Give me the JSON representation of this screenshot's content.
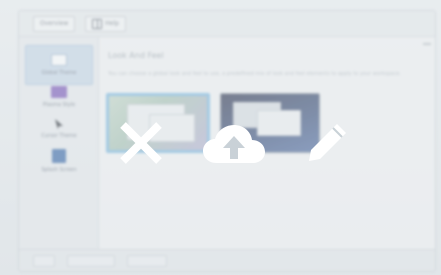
{
  "window": {
    "toolbar": {
      "left_button": "Overview",
      "right_button": "Help"
    },
    "sidebar": {
      "items": [
        {
          "label": "Global Theme",
          "icon": "theme-icon",
          "color": "#5a8fc6"
        },
        {
          "label": "Plasma Style",
          "icon": "plasma-icon",
          "color": "#7a58b8"
        },
        {
          "label": "Cursor Theme",
          "icon": "cursor-icon",
          "color": "#2b2f36"
        },
        {
          "label": "Splash Screen",
          "icon": "splash-icon",
          "color": "#3b6aa8"
        }
      ]
    },
    "content": {
      "heading": "Look And Feel",
      "description": "You can choose a global look and feel to use, a predefined mix of look and feel elements to apply to your workspace."
    },
    "statusbar": {
      "left": "Help",
      "middle": "Defaults",
      "right": "Reset"
    }
  },
  "overlay_actions": [
    {
      "name": "remove",
      "icon": "close-icon"
    },
    {
      "name": "upload",
      "icon": "cloud-upload-icon"
    },
    {
      "name": "edit",
      "icon": "pencil-icon"
    }
  ],
  "colors": {
    "accent": "#7cb8e0",
    "overlay_icon": "#ffffff",
    "dark_wallpaper": "#2e3550"
  }
}
